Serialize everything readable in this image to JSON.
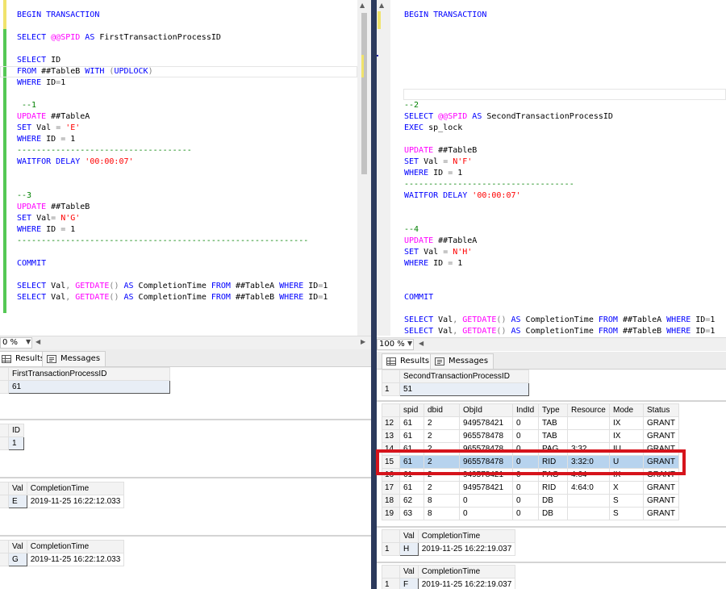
{
  "left": {
    "editor": {
      "lines": [
        {
          "text": "BEGIN TRANSACTION",
          "tokens": [
            [
              "BEGIN TRANSACTION",
              "kw"
            ]
          ]
        },
        {
          "text": "SELECT @@SPID AS FirstTransactionProcessID",
          "tokens": [
            [
              "SELECT ",
              "kw"
            ],
            [
              "@@SPID",
              "fn"
            ],
            [
              " AS ",
              "kw"
            ],
            [
              "FirstTransactionProcessID",
              "tx"
            ]
          ]
        },
        {
          "text": "SELECT ID",
          "tokens": [
            [
              "SELECT ",
              "kw"
            ],
            [
              "ID",
              "tx"
            ]
          ]
        },
        {
          "text": "FROM ##TableB WITH (UPDLOCK)",
          "tokens": [
            [
              "FROM ",
              "kw"
            ],
            [
              "##TableB ",
              "tx"
            ],
            [
              "WITH ",
              "kw"
            ],
            [
              "(",
              "op"
            ],
            [
              "UPDLOCK",
              "kw"
            ],
            [
              ")",
              "op"
            ]
          ]
        },
        {
          "text": "WHERE ID=1",
          "tokens": [
            [
              "WHERE ",
              "kw"
            ],
            [
              "ID",
              "tx"
            ],
            [
              "=",
              "op"
            ],
            [
              "1",
              "tx"
            ]
          ]
        },
        {
          "text": " --1",
          "tokens": [
            [
              " --1",
              "cmt"
            ]
          ]
        },
        {
          "text": "UPDATE ##TableA",
          "tokens": [
            [
              "UPDATE ",
              "fn"
            ],
            [
              "##TableA",
              "tx"
            ]
          ]
        },
        {
          "text": "SET Val = 'E'",
          "tokens": [
            [
              "SET ",
              "kw"
            ],
            [
              "Val ",
              "tx"
            ],
            [
              "= ",
              "op"
            ],
            [
              "'E'",
              "str"
            ]
          ]
        },
        {
          "text": "WHERE ID = 1",
          "tokens": [
            [
              "WHERE ",
              "kw"
            ],
            [
              "ID ",
              "tx"
            ],
            [
              "= ",
              "op"
            ],
            [
              "1",
              "tx"
            ]
          ]
        },
        {
          "text": "------------------------------------",
          "tokens": [
            [
              "------------------------------------",
              "cmt"
            ]
          ]
        },
        {
          "text": "WAITFOR DELAY '00:00:07'",
          "tokens": [
            [
              "WAITFOR DELAY ",
              "kw"
            ],
            [
              "'00:00:07'",
              "str"
            ]
          ]
        },
        {
          "text": "--3",
          "tokens": [
            [
              "--3",
              "cmt"
            ]
          ]
        },
        {
          "text": "UPDATE ##TableB",
          "tokens": [
            [
              "UPDATE ",
              "fn"
            ],
            [
              "##TableB",
              "tx"
            ]
          ]
        },
        {
          "text": "SET Val= N'G'",
          "tokens": [
            [
              "SET ",
              "kw"
            ],
            [
              "Val",
              "tx"
            ],
            [
              "= ",
              "op"
            ],
            [
              "N'G'",
              "str"
            ]
          ]
        },
        {
          "text": "WHERE ID = 1",
          "tokens": [
            [
              "WHERE ",
              "kw"
            ],
            [
              "ID ",
              "tx"
            ],
            [
              "= ",
              "op"
            ],
            [
              "1",
              "tx"
            ]
          ]
        },
        {
          "text": "------------------------------------------------------------",
          "tokens": [
            [
              "------------------------------------------------------------",
              "cmt"
            ]
          ]
        },
        {
          "text": "COMMIT",
          "tokens": [
            [
              "COMMIT",
              "kw"
            ]
          ]
        },
        {
          "text": "SELECT Val, GETDATE() AS CompletionTime FROM ##TableA WHERE ID=1",
          "tokens": [
            [
              "SELECT ",
              "kw"
            ],
            [
              "Val",
              "tx"
            ],
            [
              ", ",
              "op"
            ],
            [
              "GETDATE",
              "fn"
            ],
            [
              "() ",
              "op"
            ],
            [
              "AS ",
              "kw"
            ],
            [
              "CompletionTime ",
              "tx"
            ],
            [
              "FROM ",
              "kw"
            ],
            [
              "##TableA ",
              "tx"
            ],
            [
              "WHERE ",
              "kw"
            ],
            [
              "ID",
              "tx"
            ],
            [
              "=",
              "op"
            ],
            [
              "1",
              "tx"
            ]
          ]
        },
        {
          "text": "SELECT Val, GETDATE() AS CompletionTime FROM ##TableB WHERE ID=1",
          "tokens": [
            [
              "SELECT ",
              "kw"
            ],
            [
              "Val",
              "tx"
            ],
            [
              ", ",
              "op"
            ],
            [
              "GETDATE",
              "fn"
            ],
            [
              "() ",
              "op"
            ],
            [
              "AS ",
              "kw"
            ],
            [
              "CompletionTime ",
              "tx"
            ],
            [
              "FROM ",
              "kw"
            ],
            [
              "##TableB ",
              "tx"
            ],
            [
              "WHERE ",
              "kw"
            ],
            [
              "ID",
              "tx"
            ],
            [
              "=",
              "op"
            ],
            [
              "1",
              "tx"
            ]
          ]
        }
      ]
    },
    "zoom": "0 %",
    "tabs": {
      "results": "Results",
      "messages": "Messages"
    },
    "grids": [
      {
        "columns": [
          "FirstTransactionProcessID"
        ],
        "rows": [
          [
            "1",
            "61"
          ]
        ]
      },
      {
        "columns": [
          "ID"
        ],
        "rows": [
          [
            "1",
            "1"
          ]
        ]
      },
      {
        "columns": [
          "Val",
          "CompletionTime"
        ],
        "rows": [
          [
            "1",
            "E",
            "2019-11-25 16:22:12.033"
          ]
        ]
      },
      {
        "columns": [
          "Val",
          "CompletionTime"
        ],
        "rows": [
          [
            "1",
            "G",
            "2019-11-25 16:22:12.033"
          ]
        ]
      }
    ]
  },
  "right": {
    "editor": {
      "lines": [
        {
          "text": "BEGIN TRANSACTION",
          "tokens": [
            [
              "BEGIN TRANSACTION",
              "kw"
            ]
          ]
        },
        {
          "text": "--2",
          "tokens": [
            [
              "--2",
              "cmt"
            ]
          ]
        },
        {
          "text": "SELECT @@SPID AS SecondTransactionProcessID",
          "tokens": [
            [
              "SELECT ",
              "kw"
            ],
            [
              "@@SPID",
              "fn"
            ],
            [
              " AS ",
              "kw"
            ],
            [
              "SecondTransactionProcessID",
              "tx"
            ]
          ]
        },
        {
          "text": "EXEC sp_lock",
          "tokens": [
            [
              "EXEC ",
              "kw"
            ],
            [
              "sp_lock",
              "tx"
            ]
          ]
        },
        {
          "text": "UPDATE ##TableB",
          "tokens": [
            [
              "UPDATE ",
              "fn"
            ],
            [
              "##TableB",
              "tx"
            ]
          ]
        },
        {
          "text": "SET Val = N'F'",
          "tokens": [
            [
              "SET ",
              "kw"
            ],
            [
              "Val ",
              "tx"
            ],
            [
              "= ",
              "op"
            ],
            [
              "N'F'",
              "str"
            ]
          ]
        },
        {
          "text": "WHERE ID = 1",
          "tokens": [
            [
              "WHERE ",
              "kw"
            ],
            [
              "ID ",
              "tx"
            ],
            [
              "= ",
              "op"
            ],
            [
              "1",
              "tx"
            ]
          ]
        },
        {
          "text": "-----------------------------------",
          "tokens": [
            [
              "-----------------------------------",
              "cmt"
            ]
          ]
        },
        {
          "text": "WAITFOR DELAY '00:00:07'",
          "tokens": [
            [
              "WAITFOR DELAY ",
              "kw"
            ],
            [
              "'00:00:07'",
              "str"
            ]
          ]
        },
        {
          "text": "--4",
          "tokens": [
            [
              "--4",
              "cmt"
            ]
          ]
        },
        {
          "text": "UPDATE ##TableA",
          "tokens": [
            [
              "UPDATE ",
              "fn"
            ],
            [
              "##TableA",
              "tx"
            ]
          ]
        },
        {
          "text": "SET Val = N'H'",
          "tokens": [
            [
              "SET ",
              "kw"
            ],
            [
              "Val ",
              "tx"
            ],
            [
              "= ",
              "op"
            ],
            [
              "N'H'",
              "str"
            ]
          ]
        },
        {
          "text": "WHERE ID = 1",
          "tokens": [
            [
              "WHERE ",
              "kw"
            ],
            [
              "ID ",
              "tx"
            ],
            [
              "= ",
              "op"
            ],
            [
              "1",
              "tx"
            ]
          ]
        },
        {
          "text": "COMMIT",
          "tokens": [
            [
              "COMMIT",
              "kw"
            ]
          ]
        },
        {
          "text": "SELECT Val, GETDATE() AS CompletionTime FROM ##TableA WHERE ID=1",
          "tokens": [
            [
              "SELECT ",
              "kw"
            ],
            [
              "Val",
              "tx"
            ],
            [
              ", ",
              "op"
            ],
            [
              "GETDATE",
              "fn"
            ],
            [
              "() ",
              "op"
            ],
            [
              "AS ",
              "kw"
            ],
            [
              "CompletionTime ",
              "tx"
            ],
            [
              "FROM ",
              "kw"
            ],
            [
              "##TableA ",
              "tx"
            ],
            [
              "WHERE ",
              "kw"
            ],
            [
              "ID",
              "tx"
            ],
            [
              "=",
              "op"
            ],
            [
              "1",
              "tx"
            ]
          ]
        },
        {
          "text": "SELECT Val, GETDATE() AS CompletionTime FROM ##TableB WHERE ID=1",
          "tokens": [
            [
              "SELECT ",
              "kw"
            ],
            [
              "Val",
              "tx"
            ],
            [
              ", ",
              "op"
            ],
            [
              "GETDATE",
              "fn"
            ],
            [
              "() ",
              "op"
            ],
            [
              "AS ",
              "kw"
            ],
            [
              "CompletionTime ",
              "tx"
            ],
            [
              "FROM ",
              "kw"
            ],
            [
              "##TableB ",
              "tx"
            ],
            [
              "WHERE ",
              "kw"
            ],
            [
              "ID",
              "tx"
            ],
            [
              "=",
              "op"
            ],
            [
              "1",
              "tx"
            ]
          ]
        }
      ]
    },
    "zoom": "100 %",
    "tabs": {
      "results": "Results",
      "messages": "Messages"
    },
    "spid_grid": {
      "columns": [
        "SecondTransactionProcessID"
      ],
      "rows": [
        [
          "1",
          "51"
        ]
      ]
    },
    "lock_grid": {
      "columns": [
        "spid",
        "dbid",
        "ObjId",
        "IndId",
        "Type",
        "Resource",
        "Mode",
        "Status"
      ],
      "rows": [
        [
          "12",
          "61",
          "2",
          "949578421",
          "0",
          "TAB",
          "",
          "IX",
          "GRANT"
        ],
        [
          "13",
          "61",
          "2",
          "965578478",
          "0",
          "TAB",
          "",
          "IX",
          "GRANT"
        ],
        [
          "14",
          "61",
          "2",
          "965578478",
          "0",
          "PAG",
          "3:32",
          "IU",
          "GRANT"
        ],
        [
          "15",
          "61",
          "2",
          "965578478",
          "0",
          "RID",
          "3:32:0",
          "U",
          "GRANT"
        ],
        [
          "16",
          "61",
          "2",
          "949578421",
          "0",
          "PAG",
          "4:64",
          "IX",
          "GRANT"
        ],
        [
          "17",
          "61",
          "2",
          "949578421",
          "0",
          "RID",
          "4:64:0",
          "X",
          "GRANT"
        ],
        [
          "18",
          "62",
          "8",
          "0",
          "0",
          "DB",
          "",
          "S",
          "GRANT"
        ],
        [
          "19",
          "63",
          "8",
          "0",
          "0",
          "DB",
          "",
          "S",
          "GRANT"
        ]
      ],
      "highlighted_row": 3
    },
    "val_grids": [
      {
        "columns": [
          "Val",
          "CompletionTime"
        ],
        "rows": [
          [
            "1",
            "H",
            "2019-11-25 16:22:19.037"
          ]
        ]
      },
      {
        "columns": [
          "Val",
          "CompletionTime"
        ],
        "rows": [
          [
            "1",
            "F",
            "2019-11-25 16:22:19.037"
          ]
        ]
      }
    ]
  },
  "colors": {
    "highlight_border": "#d6141c",
    "selected_row": "#b7d3ee",
    "change_bar": "#55c855",
    "splitter": "#2c3a5c"
  }
}
